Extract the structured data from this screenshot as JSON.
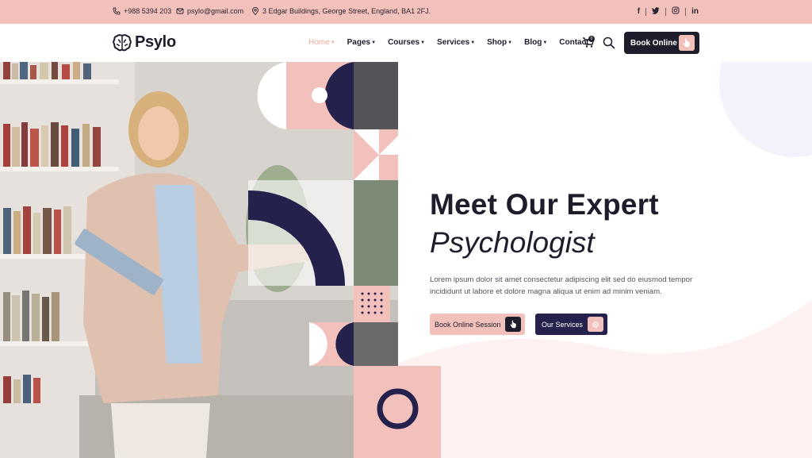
{
  "topbar": {
    "phone": "+988 5394 203",
    "email": "psylo@gmail.com",
    "address": "3 Edgar Buildings, George Street, England, BA1 2FJ.",
    "social": [
      "f",
      "twitter-icon",
      "instagram-icon",
      "in"
    ]
  },
  "brand": {
    "name": "Psylo"
  },
  "nav": {
    "items": [
      {
        "label": "Home",
        "active": true,
        "caret": true
      },
      {
        "label": "Pages",
        "active": false,
        "caret": true
      },
      {
        "label": "Courses",
        "active": false,
        "caret": true
      },
      {
        "label": "Services",
        "active": false,
        "caret": true
      },
      {
        "label": "Shop",
        "active": false,
        "caret": true
      },
      {
        "label": "Blog",
        "active": false,
        "caret": true
      },
      {
        "label": "Contact",
        "active": false,
        "caret": false
      }
    ],
    "cart_count": "0",
    "book_label": "Book Online"
  },
  "hero": {
    "title_line1": "Meet Our Expert",
    "title_line2": "Psychologist",
    "lead": "Lorem ipsum dolor sit amet consectetur adipiscing elit sed do eiusmod tempor incididunt ut labore et dolore magna aliqua ut enim ad minim veniam.",
    "primary_button": "Book Online Session",
    "secondary_button": "Our Services"
  },
  "colors": {
    "accent_pink": "#f3c1bc",
    "navy": "#24214c",
    "dark": "#1e1d2b"
  }
}
